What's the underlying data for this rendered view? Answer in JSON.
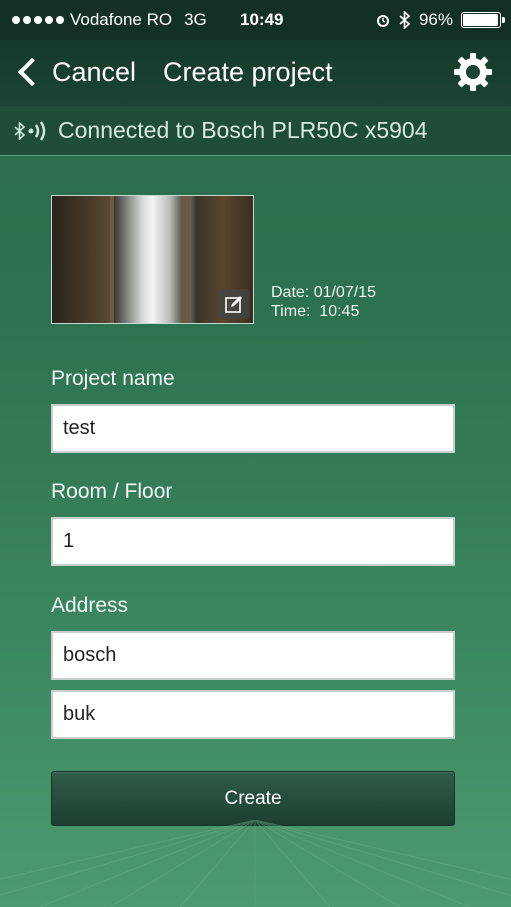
{
  "status_bar": {
    "carrier": "Vodafone RO",
    "network": "3G",
    "time": "10:49",
    "battery": "96%",
    "battery_level": 0.96
  },
  "nav": {
    "back_label": "Cancel",
    "title": "Create project",
    "settings_icon": "gear-icon"
  },
  "connection": {
    "icon": "bluetooth-signal-icon",
    "text": "Connected to Bosch PLR50C x5904"
  },
  "photo": {
    "edit_icon": "pencil-edit-icon",
    "date_line": "Date: 01/07/15",
    "time_line": "Time:  10:45"
  },
  "form": {
    "project_name_label": "Project name",
    "project_name_value": "test",
    "room_floor_label": "Room / Floor",
    "room_floor_value": "1",
    "address_label": "Address",
    "address_line1_value": "bosch",
    "address_line2_value": "buk"
  },
  "actions": {
    "create_label": "Create"
  },
  "colors": {
    "background": "#2d7250",
    "nav_background": "#163a2b",
    "button": "#1d3f30"
  }
}
